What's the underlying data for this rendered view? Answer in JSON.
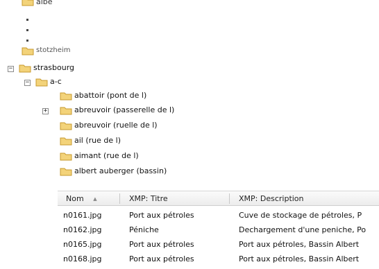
{
  "tree": {
    "partial_top_label": "albe",
    "partial_label_2": "stotzheim",
    "parent": {
      "label": "strasbourg",
      "expander": "−"
    },
    "group": {
      "label": "a-c",
      "expander": "−"
    },
    "items": [
      {
        "label": "abattoir (pont de l)"
      },
      {
        "label": "abreuvoir (passerelle de l)",
        "expander": "+"
      },
      {
        "label": "abreuvoir (ruelle de l)"
      },
      {
        "label": "ail (rue de l)"
      },
      {
        "label": "aimant (rue de l)"
      },
      {
        "label": "albert auberger (bassin)"
      }
    ]
  },
  "table": {
    "columns": [
      {
        "label": "Nom",
        "sort_indicator": "▲"
      },
      {
        "label": "XMP: Titre"
      },
      {
        "label": "XMP: Description"
      }
    ],
    "rows": [
      {
        "name": "n0161.jpg",
        "title": "Port aux pétroles",
        "description": "Cuve de stockage de pétroles, P"
      },
      {
        "name": "n0162.jpg",
        "title": "Péniche",
        "description": "Dechargement d'une peniche, Po"
      },
      {
        "name": "n0165.jpg",
        "title": "Port aux pétroles",
        "description": "Port aux pétroles, Bassin Albert"
      },
      {
        "name": "n0168.jpg",
        "title": "Port aux pétroles",
        "description": "Port aux pétroles, Bassin Albert"
      }
    ]
  },
  "colors": {
    "folder_fill": "#f3d37a",
    "folder_edge": "#c79a2e"
  }
}
